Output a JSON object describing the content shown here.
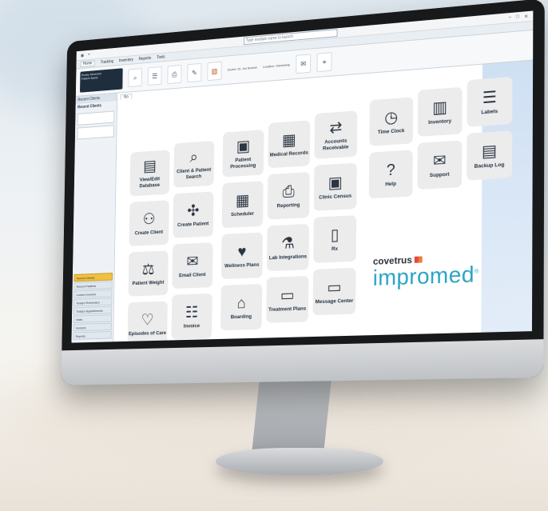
{
  "app": {
    "module_search_placeholder": "Type module name to launch",
    "menu_tabs": [
      "Home",
      "Tracking",
      "Inventory",
      "Reports",
      "Tools"
    ],
    "patient_box_lines": [
      "Rocky Simmons",
      "Patient Name"
    ],
    "toolbar": {
      "field_doctor_label": "Doctor:",
      "field_doctor_value": "Dr. Jon Bonnet",
      "field_location_label": "Location:",
      "field_location_value": "Ownership"
    }
  },
  "sidebar": {
    "header": "Recent Clients",
    "section": "Recent Clients",
    "nav_items": [
      "Recent Clients",
      "Recent Patients",
      "Locked Invoices",
      "Today's Reminders",
      "Today's Appointments",
      "Visits",
      "Invoices",
      "Reports"
    ]
  },
  "main": {
    "tab_label": "Go",
    "tiles": [
      {
        "label": "View/Edit Database",
        "icon": "database-icon",
        "glyph": "▤"
      },
      {
        "label": "Client & Patient Search",
        "icon": "search-icon",
        "glyph": "⌕"
      },
      {
        "label": "Patient Processing",
        "icon": "patient-processing-icon",
        "glyph": "▣"
      },
      {
        "label": "Medical Records",
        "icon": "medical-records-icon",
        "glyph": "▦"
      },
      {
        "label": "Accounts Receivable",
        "icon": "accounts-receivable-icon",
        "glyph": "⇄"
      },
      {
        "label": "Time Clock",
        "icon": "clock-icon",
        "glyph": "◷"
      },
      {
        "label": "Inventory",
        "icon": "barcode-icon",
        "glyph": "▥"
      },
      {
        "label": "Labels",
        "icon": "labels-icon",
        "glyph": "☰"
      },
      {
        "label": "Create Client",
        "icon": "create-client-icon",
        "glyph": "⚇"
      },
      {
        "label": "Create Patient",
        "icon": "create-patient-icon",
        "glyph": "✣"
      },
      {
        "label": "Scheduler",
        "icon": "calendar-icon",
        "glyph": "▦"
      },
      {
        "label": "Reporting",
        "icon": "printer-icon",
        "glyph": "⎙"
      },
      {
        "label": "Clinic Census",
        "icon": "census-icon",
        "glyph": "▣"
      },
      {
        "label": "Help",
        "icon": "help-icon",
        "glyph": "?"
      },
      {
        "label": "Support",
        "icon": "support-icon",
        "glyph": "✉"
      },
      {
        "label": "Backup Log",
        "icon": "backup-icon",
        "glyph": "▤"
      },
      {
        "label": "Patient Weight",
        "icon": "scale-icon",
        "glyph": "⚖"
      },
      {
        "label": "Email Client",
        "icon": "email-icon",
        "glyph": "✉"
      },
      {
        "label": "Wellness Plans",
        "icon": "wellness-icon",
        "glyph": "♥"
      },
      {
        "label": "Lab Integrations",
        "icon": "flask-icon",
        "glyph": "⚗"
      },
      {
        "label": "Rx",
        "icon": "rx-bottle-icon",
        "glyph": "▯"
      },
      {
        "label": "Episodes of Care",
        "icon": "heart-icon",
        "glyph": "♡"
      },
      {
        "label": "Invoice",
        "icon": "invoice-icon",
        "glyph": "☷"
      },
      {
        "label": "Boarding",
        "icon": "house-icon",
        "glyph": "⌂"
      },
      {
        "label": "Treatment Plans",
        "icon": "treatment-icon",
        "glyph": "▭"
      },
      {
        "label": "Message Center",
        "icon": "message-icon",
        "glyph": "▭"
      }
    ],
    "brand_top": "covetrus",
    "brand_bottom": "impromed",
    "brand_reg": "®"
  },
  "colors": {
    "brand_blue": "#2aa3c4",
    "tile_bg": "#ececec",
    "accent_yellow": "#f0c040"
  }
}
